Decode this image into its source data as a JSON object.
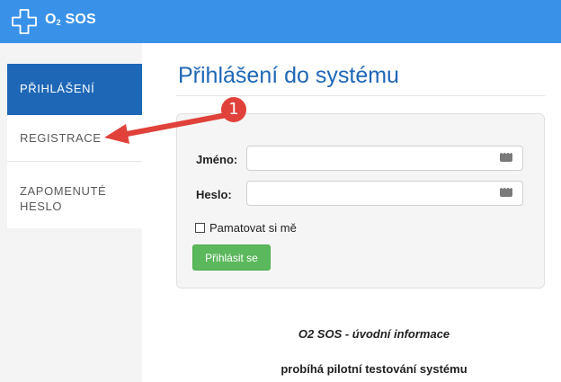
{
  "header": {
    "brand_main": "O",
    "brand_sub": "2",
    "brand_rest": " SOS",
    "logo_icon": "medical-cross-outline-icon",
    "color": "#3a92e8"
  },
  "sidebar": {
    "items": [
      {
        "label": "Přihlášení",
        "active": true
      },
      {
        "label": "Registrace",
        "active": false
      },
      {
        "label": "Zapomenuté heslo",
        "active": false
      }
    ],
    "active_color": "#1e67b6"
  },
  "main": {
    "title": "Přihlášení do systému",
    "form": {
      "name_label": "Jméno:",
      "name_value": "",
      "password_label": "Heslo:",
      "password_value": "",
      "field_icon": "password-manager-icon",
      "remember_label": "Pamatovat si mě",
      "remember_checked": false,
      "submit_label": "Přihlásit se",
      "submit_color": "#5cb85c"
    },
    "info_title": "O2 SOS - úvodní informace",
    "info_text": "probíhá pilotní testování systému"
  },
  "annotation": {
    "badge_number": "1",
    "color": "#e0413a"
  }
}
